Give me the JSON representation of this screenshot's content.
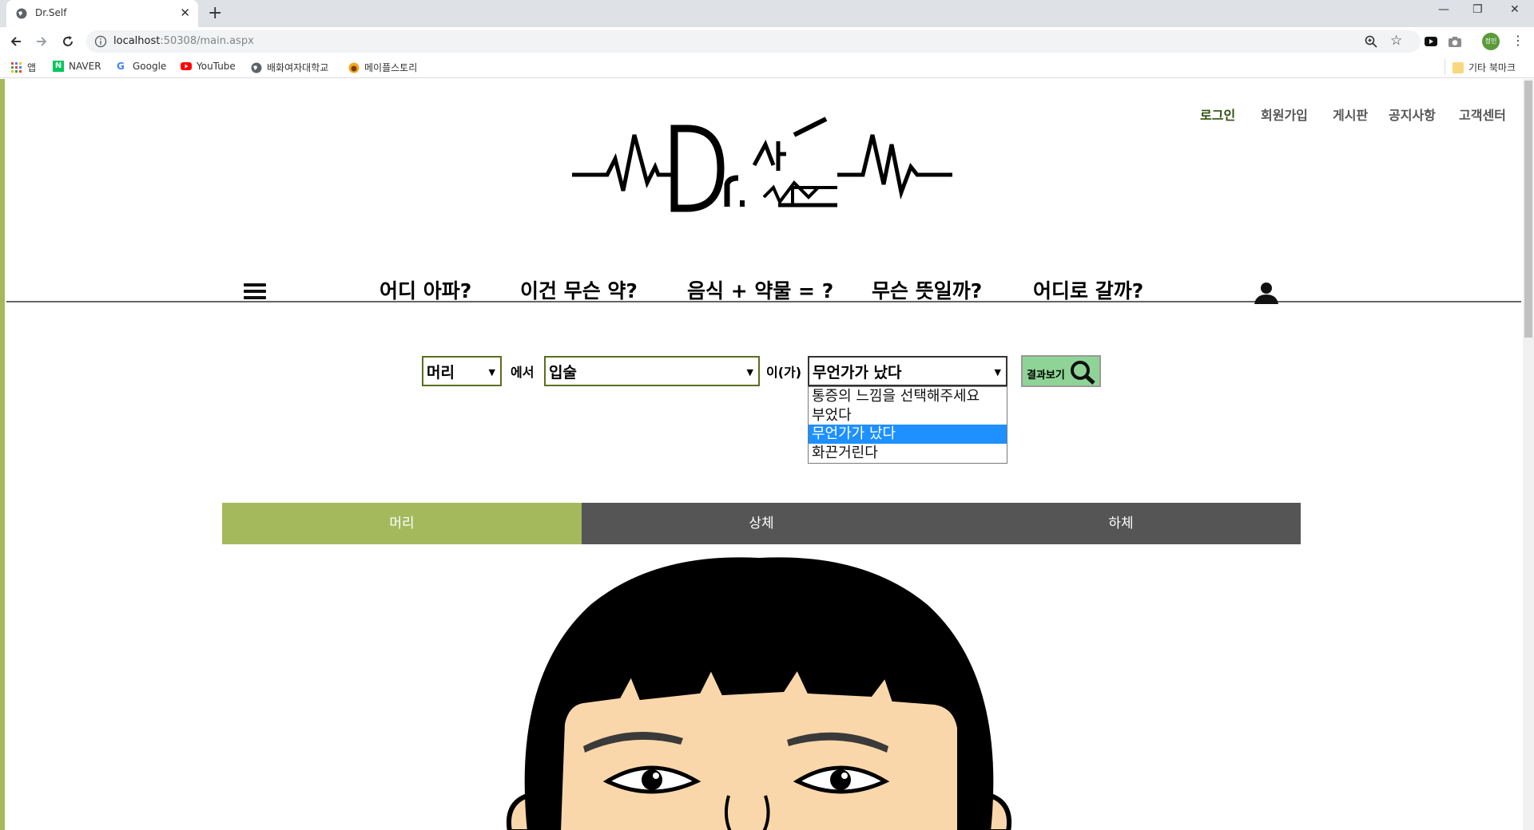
{
  "browser": {
    "tab_title": "Dr.Self",
    "url_host": "localhost",
    "url_path": ":50308/main.aspx",
    "bookmarks": [
      {
        "label": "앱",
        "icon": "apps-grid-icon"
      },
      {
        "label": "NAVER",
        "icon": "naver-icon"
      },
      {
        "label": "Google",
        "icon": "google-icon"
      },
      {
        "label": "YouTube",
        "icon": "youtube-icon"
      },
      {
        "label": "배화여자대학교",
        "icon": "globe-icon"
      },
      {
        "label": "메이플스토리",
        "icon": "maplestory-icon"
      }
    ],
    "other_bookmarks": "기타 북마크",
    "profile_initials": "정민"
  },
  "site": {
    "top_menu": [
      "로그인",
      "회원가입",
      "게시판",
      "공지사항",
      "고객센터"
    ],
    "main_nav": [
      "어디 아파?",
      "이건 무슨 약?",
      "음식 + 약물 = ?",
      "무슨 뜻일까?",
      "어디로 갈까?"
    ],
    "search": {
      "part_value": "머리",
      "joiner1": "에서",
      "detail_value": "입술",
      "joiner2": "이(가)",
      "symptom_value": "무언가가 났다",
      "result_button": "결과보기",
      "symptom_options": [
        "통증의 느낌을 선택해주세요",
        "부었다",
        "무언가가 났다",
        "화끈거린다"
      ],
      "selected_option_index": 2
    },
    "body_tabs": [
      "머리",
      "상체",
      "하체"
    ],
    "active_body_tab": 0
  },
  "colors": {
    "accent_green": "#a4b95c",
    "tab_dark": "#555555",
    "button_green": "#8fd497",
    "selection_blue": "#1e90ff"
  }
}
